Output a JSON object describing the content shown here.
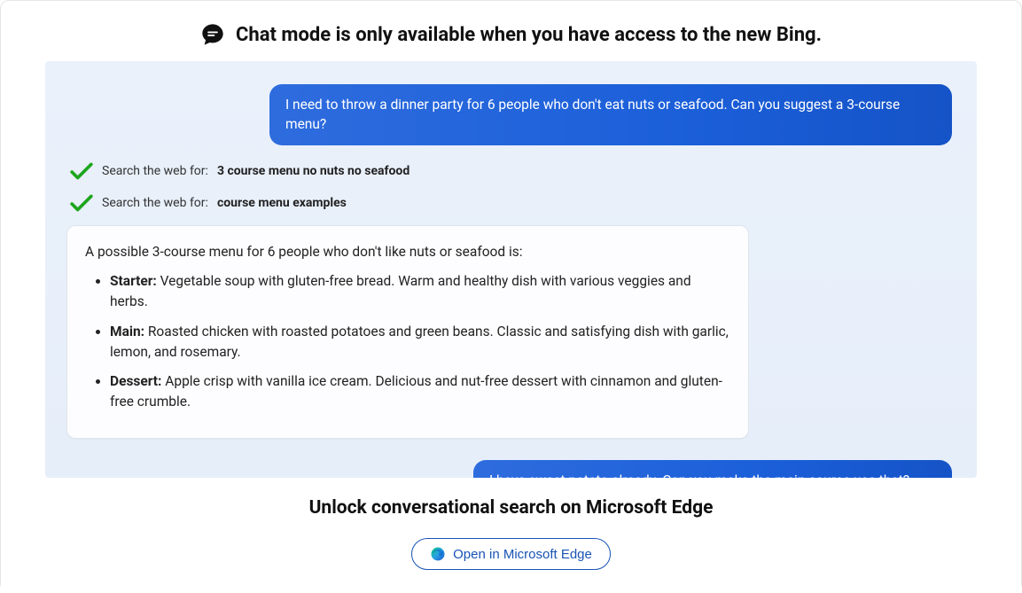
{
  "header": {
    "title": "Chat mode is only available when you have access to the new Bing."
  },
  "colors": {
    "accent": "#1853b5",
    "bubble_gradient_start": "#2e6cde",
    "bubble_gradient_end": "#1553c7",
    "check_green": "#1fa51f"
  },
  "chat": {
    "user_messages": [
      "I need to throw a dinner party for 6 people who don't eat nuts or seafood. Can you suggest a 3-course menu?",
      "I have sweet potato already. Can you make the main course use that?"
    ],
    "searches": [
      {
        "prefix": "Search the web for: ",
        "query": "3 course menu no nuts no seafood"
      },
      {
        "prefix": "Search the web for: ",
        "query": "course menu examples"
      }
    ],
    "assistant": {
      "intro": "A possible 3-course menu for 6 people who don't like nuts or seafood is:",
      "items": [
        {
          "label": "Starter:",
          "text": " Vegetable soup with gluten-free bread. Warm and healthy dish with various veggies and herbs."
        },
        {
          "label": "Main:",
          "text": " Roasted chicken with roasted potatoes and green beans. Classic and satisfying dish with garlic, lemon, and rosemary."
        },
        {
          "label": "Dessert:",
          "text": " Apple crisp with vanilla ice cream. Delicious and nut-free dessert with cinnamon and gluten-free crumble."
        }
      ]
    }
  },
  "footer": {
    "title": "Unlock conversational search on Microsoft Edge",
    "button_label": "Open in Microsoft Edge"
  }
}
